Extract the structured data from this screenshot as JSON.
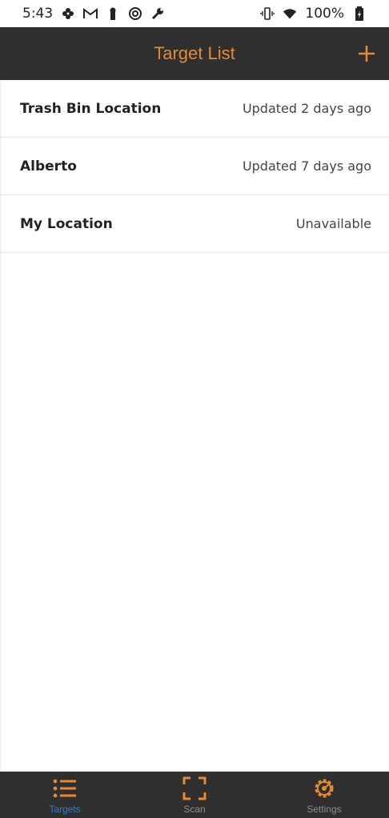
{
  "status_bar": {
    "time": "5:43",
    "battery": "100%",
    "icons_left": [
      "pinwheel-icon",
      "gmail-icon",
      "keyhole-icon",
      "sync-icon",
      "wrench-icon"
    ],
    "icons_right": [
      "vibrate-icon",
      "wifi-icon",
      "battery-icon"
    ]
  },
  "app_bar": {
    "title": "Target List",
    "add_icon": "plus-icon",
    "accent_color": "#e58a33"
  },
  "targets": [
    {
      "name": "Trash Bin Location",
      "status": "Updated 2 days ago"
    },
    {
      "name": "Alberto",
      "status": "Updated 7 days ago"
    },
    {
      "name": "My Location",
      "status": "Unavailable"
    }
  ],
  "bottom_nav": {
    "tabs": [
      {
        "label": "Targets",
        "icon": "list-icon",
        "active": true
      },
      {
        "label": "Scan",
        "icon": "scan-frame-icon",
        "active": false
      },
      {
        "label": "Settings",
        "icon": "gear-icon",
        "active": false
      }
    ],
    "active_color": "#2f7bd7",
    "icon_color": "#e58a33"
  }
}
